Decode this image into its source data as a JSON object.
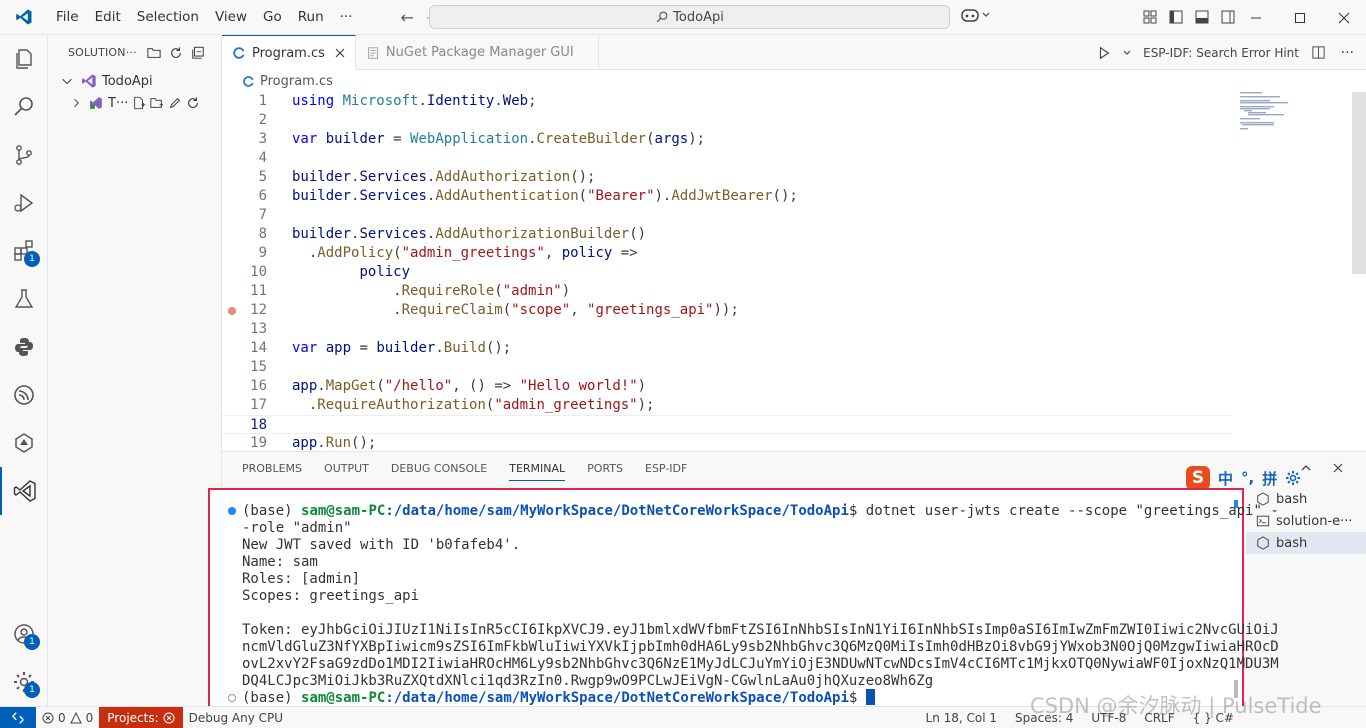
{
  "menu": [
    "File",
    "Edit",
    "Selection",
    "View",
    "Go",
    "Run",
    "···"
  ],
  "command_center": {
    "text": "TodoApi"
  },
  "sidebar": {
    "title": "SOLUTION···",
    "tree": [
      {
        "label": "TodoApi"
      },
      {
        "label": "T···"
      }
    ]
  },
  "activity_badges": {
    "extensions": "1",
    "accounts": "1",
    "manage": "1"
  },
  "tabs": [
    {
      "label": "Program.cs",
      "active": true
    },
    {
      "label": "NuGet Package Manager GUI",
      "active": false
    }
  ],
  "tab_actions": {
    "esp_idf": "ESP-IDF: Search Error Hint"
  },
  "breadcrumb": "Program.cs",
  "editor": {
    "current_line": 18,
    "lines": [
      {
        "n": "1",
        "code": "using Microsoft.Identity.Web;"
      },
      {
        "n": "2",
        "code": ""
      },
      {
        "n": "3",
        "code": "var builder = WebApplication.CreateBuilder(args);"
      },
      {
        "n": "4",
        "code": ""
      },
      {
        "n": "5",
        "code": "builder.Services.AddAuthorization();"
      },
      {
        "n": "6",
        "code": "builder.Services.AddAuthentication(\"Bearer\").AddJwtBearer();"
      },
      {
        "n": "7",
        "code": ""
      },
      {
        "n": "8",
        "code": "builder.Services.AddAuthorizationBuilder()"
      },
      {
        "n": "9",
        "code": "  .AddPolicy(\"admin_greetings\", policy =>"
      },
      {
        "n": "10",
        "code": "        policy"
      },
      {
        "n": "11",
        "code": "            .RequireRole(\"admin\")"
      },
      {
        "n": "12",
        "code": "            .RequireClaim(\"scope\", \"greetings_api\"));"
      },
      {
        "n": "13",
        "code": ""
      },
      {
        "n": "14",
        "code": "var app = builder.Build();"
      },
      {
        "n": "15",
        "code": ""
      },
      {
        "n": "16",
        "code": "app.MapGet(\"/hello\", () => \"Hello world!\")"
      },
      {
        "n": "17",
        "code": "  .RequireAuthorization(\"admin_greetings\");"
      },
      {
        "n": "18",
        "code": ""
      },
      {
        "n": "19",
        "code": "app.Run();"
      }
    ]
  },
  "panel": {
    "tabs": [
      "PROBLEMS",
      "OUTPUT",
      "DEBUG CONSOLE",
      "TERMINAL",
      "PORTS",
      "ESP-IDF"
    ],
    "active_tab": "TERMINAL",
    "ime": {
      "s": "S",
      "zh": "中",
      "punct": "°,",
      "pin": "拼"
    }
  },
  "terminal": {
    "prompt_env": "(base) ",
    "prompt_user": "sam@sam-PC",
    "prompt_path": ":/data/home/sam/MyWorkSpace/DotNetCoreWorkSpace/TodoApi",
    "prompt_dollar": "$ ",
    "command": "dotnet user-jwts create --scope \"greetings_api\" -",
    "command_wrap": "-role \"admin\"",
    "output": [
      "New JWT saved with ID 'b0fafeb4'.",
      "Name: sam",
      "Roles: [admin]",
      "Scopes: greetings_api",
      "",
      "Token: eyJhbGciOiJIUzI1NiIsInR5cCI6IkpXVCJ9.eyJ1bmlxdWVfbmFtZSI6InNhbSIsInN1YiI6InNhbSIsImp0aSI6ImIwZmFmZWI0Iiwic2NvcGUiOiJ",
      "ncmVldGluZ3NfYXBpIiwicm9sZSI6ImFkbWluIiwiYXVkIjpbImh0dHA6Ly9sb2NhbGhvc3Q6MzQ0MiIsImh0dHBzOi8vbG9jYWxob3N0OjQ0MzgwIiwiaHROcD",
      "ovL2xvY2FsaG9zdDo1MDI2IiwiaHROcHM6Ly9sb2NhbGhvc3Q6NzE1MyJdLCJuYmYiOjE3NDUwNTcwNDcsImV4cCI6MTc1MjkxOTQ0NywiaWF0IjoxNzQ1MDU3M",
      "DQ4LCJpc3MiOiJkb3RuZXQtdXNlci1qd3RzIn0.Rwgp9wO9PCLwJEiVgN-CGwlnLaAu0jhQXuzeo8Wh6Zg"
    ]
  },
  "terminal_list": [
    {
      "label": "bash",
      "selected": false
    },
    {
      "label": "solution-e···",
      "selected": false
    },
    {
      "label": "bash",
      "selected": true
    }
  ],
  "statusbar": {
    "errors": "0",
    "warnings": "0",
    "projects": "Projects:",
    "debug": "Debug Any CPU",
    "position": "Ln 18, Col 1",
    "spaces": "Spaces: 4",
    "encoding": "UTF-8",
    "eol": "CRLF",
    "language": "{ } C#"
  },
  "watermark": "CSDN @余汐脉动 | PulseTide",
  "colors": {
    "accent": "#005fb8",
    "highlight_border": "#e0264a",
    "projects_bg": "#c72e0f"
  }
}
